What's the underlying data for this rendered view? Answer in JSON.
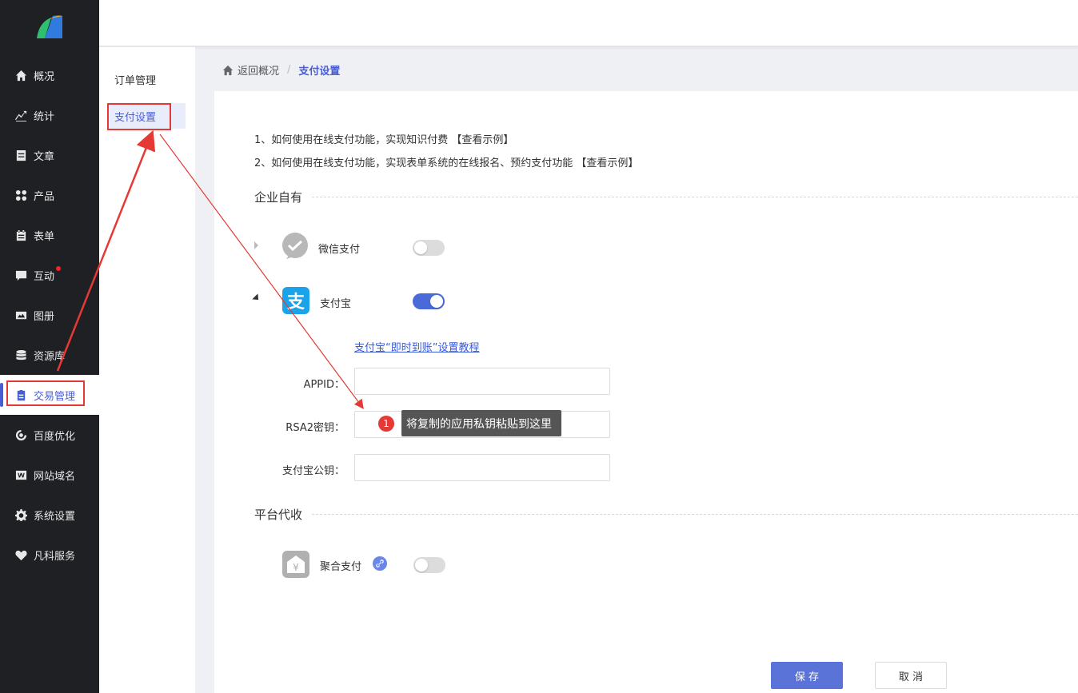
{
  "sidebar": {
    "items": [
      {
        "label": "概况",
        "icon": "home-icon"
      },
      {
        "label": "统计",
        "icon": "stats-icon"
      },
      {
        "label": "文章",
        "icon": "article-icon"
      },
      {
        "label": "产品",
        "icon": "grid-icon"
      },
      {
        "label": "表单",
        "icon": "form-icon"
      },
      {
        "label": "互动",
        "icon": "chat-icon"
      },
      {
        "label": "图册",
        "icon": "image-icon"
      },
      {
        "label": "资源库",
        "icon": "database-icon"
      },
      {
        "label": "交易管理",
        "icon": "clipboard-icon"
      },
      {
        "label": "百度优化",
        "icon": "seo-icon"
      },
      {
        "label": "网站域名",
        "icon": "w-icon"
      },
      {
        "label": "系统设置",
        "icon": "gear-icon"
      },
      {
        "label": "凡科服务",
        "icon": "heart-icon"
      }
    ]
  },
  "subnav": {
    "items": [
      {
        "label": "订单管理"
      },
      {
        "label": "支付设置"
      }
    ]
  },
  "breadcrumb": {
    "back": "返回概况",
    "separator": "/",
    "current": "支付设置"
  },
  "help": {
    "line1": "1、如何使用在线支付功能，实现知识付费",
    "line1_link": "【查看示例】",
    "line2": "2、如何使用在线支付功能，实现表单系统的在线报名、预约支付功能",
    "line2_link": "【查看示例】"
  },
  "sections": {
    "enterprise": "企业自有",
    "platform": "平台代收"
  },
  "payments": {
    "wechat": {
      "label": "微信支付",
      "enabled": false
    },
    "alipay": {
      "label": "支付宝",
      "enabled": true,
      "icon_char": "支"
    },
    "aggregate": {
      "label": "聚合支付",
      "enabled": false,
      "icon_char": "¥"
    }
  },
  "alipay_form": {
    "tutorial_link": "支付宝“即时到账”设置教程",
    "appid_label": "APPID：",
    "rsa_label": "RSA2密钥：",
    "pubkey_label": "支付宝公钥："
  },
  "tooltip": {
    "badge": "1",
    "text": "将复制的应用私钥粘贴到这里"
  },
  "buttons": {
    "save": "保 存",
    "cancel": "取 消"
  },
  "colors": {
    "accent": "#4a5ed3",
    "annotation": "#e53935",
    "sidebar_bg": "#1f2024"
  }
}
